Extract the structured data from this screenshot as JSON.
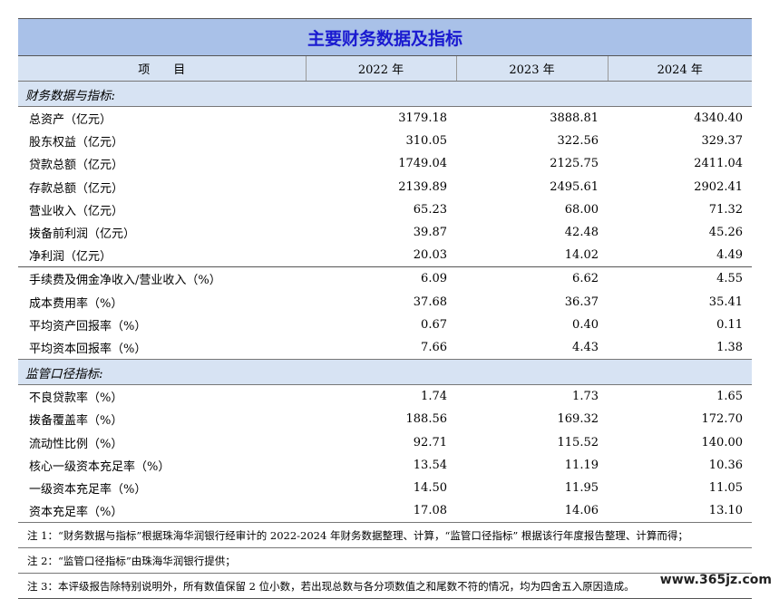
{
  "title": "主要财务数据及指标",
  "headers": [
    "项　　目",
    "2022 年",
    "2023 年",
    "2024 年"
  ],
  "sections": [
    {
      "label": "财务数据与指标:",
      "groups": [
        [
          {
            "label": "总资产（亿元）",
            "values": [
              "3179.18",
              "3888.81",
              "4340.40"
            ]
          },
          {
            "label": "股东权益（亿元）",
            "values": [
              "310.05",
              "322.56",
              "329.37"
            ]
          },
          {
            "label": "贷款总额（亿元）",
            "values": [
              "1749.04",
              "2125.75",
              "2411.04"
            ]
          },
          {
            "label": "存款总额（亿元）",
            "values": [
              "2139.89",
              "2495.61",
              "2902.41"
            ]
          },
          {
            "label": "营业收入（亿元）",
            "values": [
              "65.23",
              "68.00",
              "71.32"
            ]
          },
          {
            "label": "拨备前利润（亿元）",
            "values": [
              "39.87",
              "42.48",
              "45.26"
            ]
          },
          {
            "label": "净利润（亿元）",
            "values": [
              "20.03",
              "14.02",
              "4.49"
            ]
          }
        ],
        [
          {
            "label": "手续费及佣金净收入/营业收入（%）",
            "values": [
              "6.09",
              "6.62",
              "4.55"
            ]
          },
          {
            "label": "成本费用率（%）",
            "values": [
              "37.68",
              "36.37",
              "35.41"
            ]
          },
          {
            "label": "平均资产回报率（%）",
            "values": [
              "0.67",
              "0.40",
              "0.11"
            ]
          },
          {
            "label": "平均资本回报率（%）",
            "values": [
              "7.66",
              "4.43",
              "1.38"
            ]
          }
        ]
      ]
    },
    {
      "label": "监管口径指标:",
      "groups": [
        [
          {
            "label": "不良贷款率（%）",
            "values": [
              "1.74",
              "1.73",
              "1.65"
            ]
          },
          {
            "label": "拨备覆盖率（%）",
            "values": [
              "188.56",
              "169.32",
              "172.70"
            ]
          },
          {
            "label": "流动性比例（%）",
            "values": [
              "92.71",
              "115.52",
              "140.00"
            ]
          },
          {
            "label": "核心一级资本充足率（%）",
            "values": [
              "13.54",
              "11.19",
              "10.36"
            ]
          },
          {
            "label": "一级资本充足率（%）",
            "values": [
              "14.50",
              "11.95",
              "11.05"
            ]
          },
          {
            "label": "资本充足率（%）",
            "values": [
              "17.08",
              "14.06",
              "13.10"
            ]
          }
        ]
      ]
    }
  ],
  "notes": [
    "注 1：“财务数据与指标”根据珠海华润银行经审计的 2022-2024 年财务数据整理、计算，“监管口径指标” 根据该行年度报告整理、计算而得；",
    "注 2：“监管口径指标”由珠海华润银行提供；",
    "注 3：本评级报告除特别说明外，所有数值保留 2 位小数，若出现总数与各分项数值之和尾数不符的情况，均为四舍五入原因造成。"
  ],
  "watermark": "www.365jz.com"
}
